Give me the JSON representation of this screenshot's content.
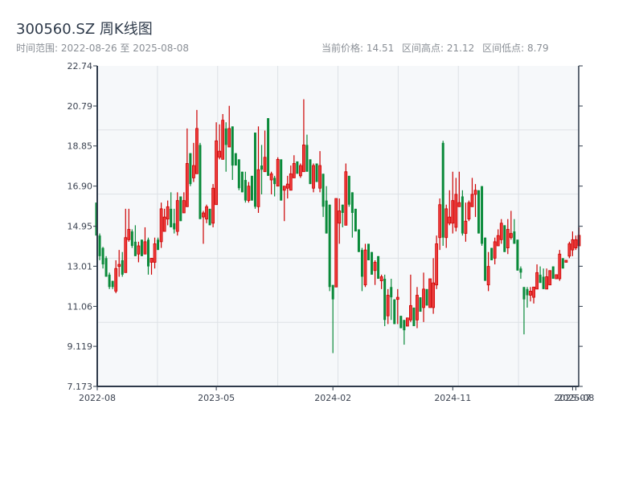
{
  "header": {
    "title": "300560.SZ 周K线图",
    "range_label": "时间范围: 2022-08-26 至 2025-08-08",
    "current_price": "当前价格: 14.51",
    "range_high": "区间高点: 21.12",
    "range_low": "区间低点: 8.79"
  },
  "colors": {
    "up": "#cc0000",
    "up_fill": "#ef3b3b",
    "down": "#0a8a3a",
    "plot_bg": "#f6f8fa",
    "grid": "#dde1e6",
    "axis": "#2e3a4a"
  },
  "chart_data": {
    "type": "candlestick",
    "title": "300560.SZ 周K线图",
    "interval": "weekly",
    "start_date": "2022-08-26",
    "end_date": "2025-08-08",
    "ylim": [
      7.173,
      22.74
    ],
    "yticks": [
      "22.74",
      "20.79",
      "18.85",
      "16.90",
      "14.95",
      "13.01",
      "11.06",
      "9.119",
      "7.173"
    ],
    "xticks": [
      {
        "label": "2022-08",
        "index": 0
      },
      {
        "label": "2023-05",
        "index": 37
      },
      {
        "label": "2024-02",
        "index": 73
      },
      {
        "label": "2024-11",
        "index": 110
      },
      {
        "label": "2025-07",
        "index": 147
      },
      {
        "label": "2025-08",
        "index": 148
      }
    ],
    "grid": true,
    "ohlc_fields": [
      "open",
      "high",
      "low",
      "close"
    ],
    "candles": [
      [
        16.1,
        16.1,
        14.5,
        14.5
      ],
      [
        14.5,
        14.6,
        13.3,
        13.5
      ],
      [
        13.9,
        13.95,
        12.9,
        13.1
      ],
      [
        13.4,
        13.5,
        12.5,
        12.5
      ],
      [
        12.6,
        12.7,
        11.9,
        12.0
      ],
      [
        12.3,
        12.3,
        11.9,
        12.0
      ],
      [
        11.8,
        13.3,
        11.7,
        12.9
      ],
      [
        13.0,
        13.8,
        12.5,
        13.1
      ],
      [
        13.3,
        13.7,
        12.5,
        12.6
      ],
      [
        12.7,
        15.8,
        12.7,
        14.4
      ],
      [
        14.3,
        15.8,
        14.2,
        14.8
      ],
      [
        14.7,
        14.8,
        13.9,
        14.0
      ],
      [
        14.2,
        15.0,
        13.5,
        13.5
      ],
      [
        13.6,
        14.2,
        13.2,
        14.0
      ],
      [
        14.3,
        14.3,
        13.5,
        13.5
      ],
      [
        13.6,
        14.9,
        13.6,
        14.2
      ],
      [
        14.3,
        14.4,
        12.6,
        13.0
      ],
      [
        13.2,
        13.4,
        12.6,
        13.4
      ],
      [
        13.2,
        14.4,
        12.9,
        14.1
      ],
      [
        14.3,
        14.4,
        13.8,
        13.8
      ],
      [
        14.2,
        16.1,
        13.9,
        15.8
      ],
      [
        14.7,
        15.8,
        14.7,
        15.4
      ],
      [
        15.3,
        16.2,
        15.0,
        15.9
      ],
      [
        15.8,
        16.6,
        14.9,
        14.9
      ],
      [
        15.1,
        15.8,
        14.6,
        14.8
      ],
      [
        14.7,
        16.6,
        14.5,
        16.2
      ],
      [
        16.4,
        16.4,
        15.2,
        15.2
      ],
      [
        15.6,
        16.6,
        15.6,
        16.2
      ],
      [
        15.9,
        19.7,
        15.9,
        18.0
      ],
      [
        18.5,
        18.5,
        16.9,
        17.0
      ],
      [
        17.3,
        19.0,
        17.1,
        17.9
      ],
      [
        17.5,
        20.6,
        17.5,
        19.7
      ],
      [
        18.9,
        19.0,
        15.3,
        15.3
      ],
      [
        15.4,
        15.7,
        14.1,
        15.6
      ],
      [
        15.3,
        16.0,
        15.1,
        15.9
      ],
      [
        15.8,
        15.8,
        15.0,
        15.0
      ],
      [
        15.1,
        17.0,
        14.9,
        16.8
      ],
      [
        16.0,
        20.0,
        16.0,
        19.1
      ],
      [
        18.3,
        19.9,
        18.2,
        18.6
      ],
      [
        18.2,
        20.4,
        18.2,
        20.1
      ],
      [
        19.7,
        20.0,
        17.6,
        18.9
      ],
      [
        18.8,
        20.8,
        18.8,
        19.7
      ],
      [
        19.8,
        19.8,
        17.2,
        17.9
      ],
      [
        18.5,
        18.5,
        17.9,
        17.9
      ],
      [
        18.2,
        18.2,
        16.7,
        16.8
      ],
      [
        17.6,
        17.6,
        16.6,
        16.6
      ],
      [
        17.2,
        17.6,
        16.1,
        16.2
      ],
      [
        16.2,
        17.1,
        16.1,
        16.9
      ],
      [
        17.4,
        17.4,
        16.2,
        16.2
      ],
      [
        19.5,
        19.5,
        15.8,
        15.9
      ],
      [
        15.9,
        19.8,
        15.6,
        17.7
      ],
      [
        17.9,
        18.9,
        16.5,
        17.7
      ],
      [
        17.6,
        19.6,
        17.6,
        18.3
      ],
      [
        20.2,
        20.2,
        17.4,
        17.4
      ],
      [
        17.2,
        17.6,
        16.5,
        17.5
      ],
      [
        17.3,
        17.4,
        16.4,
        17.0
      ],
      [
        16.9,
        18.3,
        16.9,
        18.2
      ],
      [
        18.2,
        18.2,
        16.2,
        16.2
      ],
      [
        16.7,
        16.9,
        15.2,
        16.9
      ],
      [
        16.8,
        17.4,
        16.3,
        17.0
      ],
      [
        16.7,
        17.9,
        16.7,
        17.5
      ],
      [
        17.3,
        18.4,
        17.3,
        18.0
      ],
      [
        18.1,
        18.1,
        17.5,
        17.5
      ],
      [
        17.4,
        18.0,
        17.3,
        17.9
      ],
      [
        17.6,
        21.12,
        17.6,
        18.9
      ],
      [
        18.9,
        19.4,
        17.6,
        17.6
      ],
      [
        18.2,
        18.2,
        17.0,
        17.0
      ],
      [
        16.8,
        18.0,
        16.6,
        17.9
      ],
      [
        18.0,
        18.0,
        17.1,
        17.1
      ],
      [
        16.8,
        18.6,
        16.6,
        17.9
      ],
      [
        17.5,
        17.5,
        15.4,
        15.9
      ],
      [
        16.2,
        16.9,
        14.6,
        14.6
      ],
      [
        16.0,
        16.0,
        11.8,
        12.0
      ],
      [
        12.1,
        12.1,
        8.79,
        11.4
      ],
      [
        12.0,
        16.3,
        12.0,
        16.3
      ],
      [
        15.1,
        16.3,
        14.1,
        15.7
      ],
      [
        16.0,
        16.0,
        14.9,
        15.6
      ],
      [
        15.0,
        18.0,
        15.0,
        17.6
      ],
      [
        17.4,
        17.4,
        15.9,
        16.0
      ],
      [
        16.6,
        16.6,
        14.4,
        15.6
      ],
      [
        15.8,
        15.8,
        14.7,
        14.7
      ],
      [
        14.8,
        14.8,
        13.7,
        13.7
      ],
      [
        13.8,
        13.9,
        11.8,
        12.5
      ],
      [
        12.1,
        14.1,
        12.0,
        13.8
      ],
      [
        14.1,
        14.1,
        13.3,
        13.3
      ],
      [
        13.7,
        13.7,
        12.6,
        12.6
      ],
      [
        12.8,
        13.3,
        12.1,
        13.2
      ],
      [
        13.5,
        13.5,
        12.4,
        12.4
      ],
      [
        12.3,
        12.6,
        11.9,
        12.5
      ],
      [
        12.4,
        12.6,
        10.1,
        10.4
      ],
      [
        10.6,
        11.9,
        10.2,
        11.6
      ],
      [
        12.0,
        12.4,
        10.4,
        11.5
      ],
      [
        11.4,
        11.4,
        10.2,
        10.2
      ],
      [
        11.4,
        11.9,
        10.2,
        11.5
      ],
      [
        10.6,
        10.6,
        10.0,
        10.0
      ],
      [
        10.4,
        10.4,
        9.2,
        9.9
      ],
      [
        10.1,
        10.5,
        10.1,
        10.5
      ],
      [
        10.4,
        12.6,
        10.3,
        11.1
      ],
      [
        11.0,
        11.0,
        10.1,
        10.1
      ],
      [
        10.4,
        12.0,
        10.0,
        11.6
      ],
      [
        11.5,
        11.5,
        10.8,
        10.8
      ],
      [
        11.0,
        12.7,
        10.3,
        11.9
      ],
      [
        11.9,
        11.9,
        11.1,
        11.1
      ],
      [
        11.0,
        12.4,
        11.0,
        12.4
      ],
      [
        11.0,
        13.4,
        10.7,
        12.2
      ],
      [
        12.1,
        14.5,
        11.9,
        14.1
      ],
      [
        14.4,
        16.3,
        13.8,
        16.0
      ],
      [
        19.0,
        19.1,
        14.0,
        14.4
      ],
      [
        14.4,
        16.0,
        13.9,
        15.8
      ],
      [
        15.1,
        16.7,
        15.0,
        15.4
      ],
      [
        15.1,
        17.6,
        14.6,
        16.2
      ],
      [
        14.9,
        17.3,
        14.7,
        16.5
      ],
      [
        15.9,
        17.6,
        15.9,
        16.1
      ],
      [
        16.4,
        16.7,
        14.5,
        14.6
      ],
      [
        14.6,
        16.1,
        14.2,
        15.2
      ],
      [
        15.3,
        16.2,
        15.2,
        16.1
      ],
      [
        15.9,
        17.3,
        15.9,
        16.5
      ],
      [
        16.5,
        17.0,
        15.4,
        16.7
      ],
      [
        16.7,
        16.7,
        14.6,
        14.6
      ],
      [
        16.9,
        16.9,
        14.0,
        14.1
      ],
      [
        14.4,
        14.4,
        12.3,
        12.3
      ],
      [
        12.1,
        13.7,
        11.8,
        13.0
      ],
      [
        13.9,
        13.9,
        13.3,
        13.3
      ],
      [
        13.4,
        14.4,
        13.1,
        14.2
      ],
      [
        14.0,
        14.8,
        14.0,
        14.5
      ],
      [
        14.3,
        15.3,
        14.1,
        15.1
      ],
      [
        15.0,
        15.0,
        13.7,
        13.7
      ],
      [
        13.9,
        15.3,
        13.6,
        14.8
      ],
      [
        14.4,
        15.7,
        14.3,
        14.6
      ],
      [
        14.7,
        15.3,
        14.1,
        14.1
      ],
      [
        14.3,
        14.3,
        12.8,
        12.8
      ],
      [
        12.9,
        13.0,
        12.4,
        12.7
      ],
      [
        12.0,
        12.0,
        9.7,
        11.4
      ],
      [
        11.9,
        12.0,
        11.0,
        11.6
      ],
      [
        11.6,
        12.0,
        11.3,
        11.8
      ],
      [
        11.5,
        12.0,
        11.2,
        12.0
      ],
      [
        11.9,
        13.1,
        11.9,
        12.7
      ],
      [
        12.6,
        13.0,
        12.2,
        12.2
      ],
      [
        12.5,
        12.9,
        11.9,
        11.9
      ],
      [
        11.9,
        12.9,
        11.9,
        12.5
      ],
      [
        12.1,
        12.8,
        12.1,
        12.8
      ],
      [
        13.0,
        13.0,
        12.4,
        12.4
      ],
      [
        12.4,
        12.6,
        12.4,
        12.6
      ],
      [
        12.4,
        13.8,
        12.3,
        13.6
      ],
      [
        13.4,
        13.4,
        12.9,
        12.9
      ],
      [
        13.2,
        13.3,
        13.2,
        13.3
      ],
      [
        13.5,
        14.2,
        13.4,
        14.1
      ],
      [
        13.8,
        14.7,
        13.5,
        14.3
      ],
      [
        13.9,
        14.5,
        13.8,
        14.3
      ],
      [
        14.0,
        14.9,
        14.0,
        14.51
      ]
    ]
  }
}
